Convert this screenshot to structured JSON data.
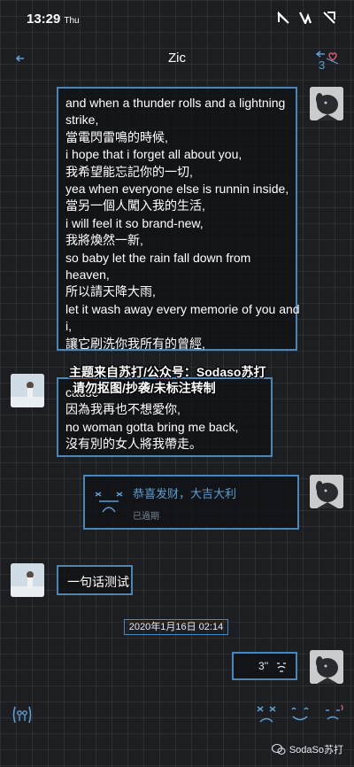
{
  "status_bar": {
    "time": "13:29",
    "day": "Thu"
  },
  "header": {
    "title": "Zic"
  },
  "messages": {
    "lyrics_1": [
      "and when a thunder rolls and a lightning",
      "strike,",
      "當電閃雷鳴的時候,",
      "i hope that i forget all about you,",
      "我希望能忘記你的一切,",
      "yea when everyone else is runnin inside,",
      "當另一個人闖入我的生活,",
      "i will feel it so brand-new,",
      "我將煥然一新,",
      "so baby let the rain fall down from",
      "heaven,",
      "所以請天降大雨,",
      "let it wash away every memorie of you and",
      "i,",
      "讓它刷洗你我所有的曾經,"
    ],
    "lyrics_2": [
      "cause",
      "因為我再也不想愛你,",
      "no woman gotta bring me back,",
      "沒有別的女人將我帶走。"
    ],
    "red_packet": {
      "title": "恭喜发财，大吉大利",
      "status": "已過期"
    },
    "short_text": "一句话测试",
    "timestamp": "2020年1月16日 02:14",
    "voice_duration": "3''"
  },
  "watermark": {
    "line1": "主题来自苏打/公众号：Sodaso苏打",
    "line2": "请勿抠图/抄袭/未标注转制"
  },
  "branding": {
    "label": "SodaSo苏打"
  },
  "colors": {
    "accent": "#4a86b8",
    "red_packet_text": "#5b9ed2",
    "background": "#1c1e22"
  }
}
